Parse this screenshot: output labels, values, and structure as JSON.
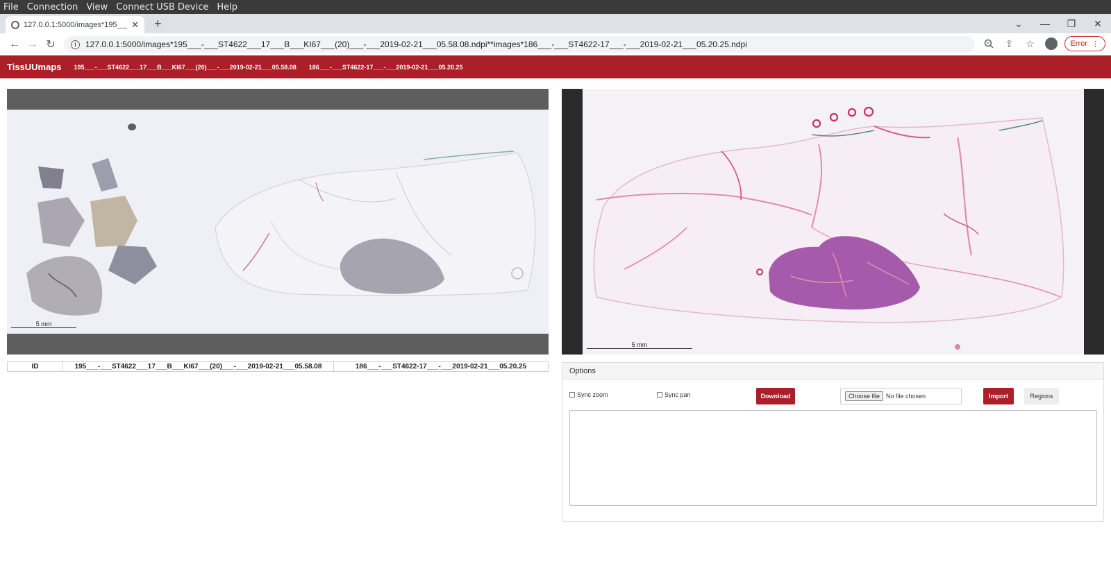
{
  "os_menu": [
    "File",
    "Connection",
    "View",
    "Connect USB Device",
    "Help"
  ],
  "browser": {
    "tab_title": "127.0.0.1:5000/images*195___-...",
    "url": "127.0.0.1:5000/images*195___-___ST4622___17___B___KI67___(20)___-___2019-02-21___05.58.08.ndpi**images*186___-___ST4622-17___-___2019-02-21___05.20.25.ndpi",
    "error_label": "Error"
  },
  "app": {
    "brand": "TissUUmaps",
    "links": [
      "195___-___ST4622___17___B___KI67___(20)___-___2019-02-21___05.58.08",
      "186___-___ST4622-17___-___2019-02-21___05.20.25"
    ]
  },
  "viewers": {
    "left_scale": "5 mm",
    "right_scale": "5 mm"
  },
  "id_table": {
    "header": "ID",
    "cells": [
      "195___-___ST4622___17___B___KI67___(20)___-___2019-02-21___05.58.08",
      "186___-___ST4622-17___-___2019-02-21___05.20.25"
    ]
  },
  "options": {
    "title": "Options",
    "sync_zoom": "Sync zoom",
    "sync_pan": "Sync pan",
    "download": "Download",
    "choose_file": "Choose file",
    "no_file": "No file chosen",
    "import": "Import",
    "regions": "Regions"
  },
  "colors": {
    "brand_red": "#ab1f28",
    "he_purple": "#9b4fa3",
    "he_pink": "#e58fb0"
  }
}
